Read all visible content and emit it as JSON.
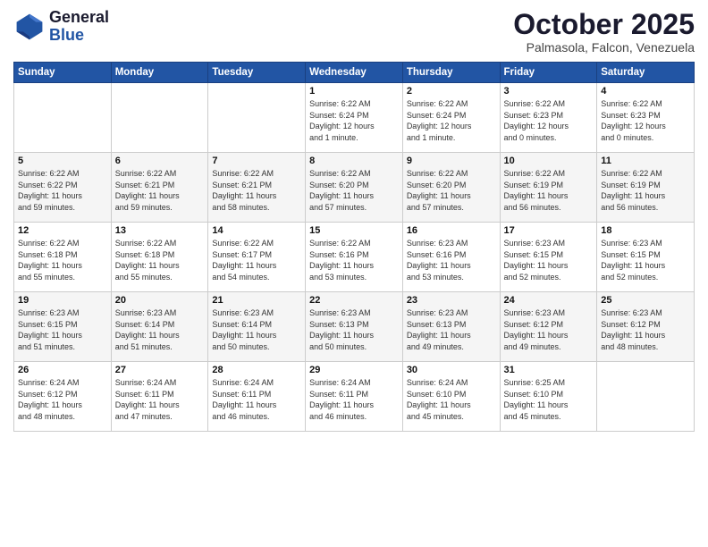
{
  "logo": {
    "line1": "General",
    "line2": "Blue"
  },
  "header": {
    "title": "October 2025",
    "subtitle": "Palmasola, Falcon, Venezuela"
  },
  "weekdays": [
    "Sunday",
    "Monday",
    "Tuesday",
    "Wednesday",
    "Thursday",
    "Friday",
    "Saturday"
  ],
  "weeks": [
    [
      {
        "day": "",
        "info": ""
      },
      {
        "day": "",
        "info": ""
      },
      {
        "day": "",
        "info": ""
      },
      {
        "day": "1",
        "info": "Sunrise: 6:22 AM\nSunset: 6:24 PM\nDaylight: 12 hours\nand 1 minute."
      },
      {
        "day": "2",
        "info": "Sunrise: 6:22 AM\nSunset: 6:24 PM\nDaylight: 12 hours\nand 1 minute."
      },
      {
        "day": "3",
        "info": "Sunrise: 6:22 AM\nSunset: 6:23 PM\nDaylight: 12 hours\nand 0 minutes."
      },
      {
        "day": "4",
        "info": "Sunrise: 6:22 AM\nSunset: 6:23 PM\nDaylight: 12 hours\nand 0 minutes."
      }
    ],
    [
      {
        "day": "5",
        "info": "Sunrise: 6:22 AM\nSunset: 6:22 PM\nDaylight: 11 hours\nand 59 minutes."
      },
      {
        "day": "6",
        "info": "Sunrise: 6:22 AM\nSunset: 6:21 PM\nDaylight: 11 hours\nand 59 minutes."
      },
      {
        "day": "7",
        "info": "Sunrise: 6:22 AM\nSunset: 6:21 PM\nDaylight: 11 hours\nand 58 minutes."
      },
      {
        "day": "8",
        "info": "Sunrise: 6:22 AM\nSunset: 6:20 PM\nDaylight: 11 hours\nand 57 minutes."
      },
      {
        "day": "9",
        "info": "Sunrise: 6:22 AM\nSunset: 6:20 PM\nDaylight: 11 hours\nand 57 minutes."
      },
      {
        "day": "10",
        "info": "Sunrise: 6:22 AM\nSunset: 6:19 PM\nDaylight: 11 hours\nand 56 minutes."
      },
      {
        "day": "11",
        "info": "Sunrise: 6:22 AM\nSunset: 6:19 PM\nDaylight: 11 hours\nand 56 minutes."
      }
    ],
    [
      {
        "day": "12",
        "info": "Sunrise: 6:22 AM\nSunset: 6:18 PM\nDaylight: 11 hours\nand 55 minutes."
      },
      {
        "day": "13",
        "info": "Sunrise: 6:22 AM\nSunset: 6:18 PM\nDaylight: 11 hours\nand 55 minutes."
      },
      {
        "day": "14",
        "info": "Sunrise: 6:22 AM\nSunset: 6:17 PM\nDaylight: 11 hours\nand 54 minutes."
      },
      {
        "day": "15",
        "info": "Sunrise: 6:22 AM\nSunset: 6:16 PM\nDaylight: 11 hours\nand 53 minutes."
      },
      {
        "day": "16",
        "info": "Sunrise: 6:23 AM\nSunset: 6:16 PM\nDaylight: 11 hours\nand 53 minutes."
      },
      {
        "day": "17",
        "info": "Sunrise: 6:23 AM\nSunset: 6:15 PM\nDaylight: 11 hours\nand 52 minutes."
      },
      {
        "day": "18",
        "info": "Sunrise: 6:23 AM\nSunset: 6:15 PM\nDaylight: 11 hours\nand 52 minutes."
      }
    ],
    [
      {
        "day": "19",
        "info": "Sunrise: 6:23 AM\nSunset: 6:15 PM\nDaylight: 11 hours\nand 51 minutes."
      },
      {
        "day": "20",
        "info": "Sunrise: 6:23 AM\nSunset: 6:14 PM\nDaylight: 11 hours\nand 51 minutes."
      },
      {
        "day": "21",
        "info": "Sunrise: 6:23 AM\nSunset: 6:14 PM\nDaylight: 11 hours\nand 50 minutes."
      },
      {
        "day": "22",
        "info": "Sunrise: 6:23 AM\nSunset: 6:13 PM\nDaylight: 11 hours\nand 50 minutes."
      },
      {
        "day": "23",
        "info": "Sunrise: 6:23 AM\nSunset: 6:13 PM\nDaylight: 11 hours\nand 49 minutes."
      },
      {
        "day": "24",
        "info": "Sunrise: 6:23 AM\nSunset: 6:12 PM\nDaylight: 11 hours\nand 49 minutes."
      },
      {
        "day": "25",
        "info": "Sunrise: 6:23 AM\nSunset: 6:12 PM\nDaylight: 11 hours\nand 48 minutes."
      }
    ],
    [
      {
        "day": "26",
        "info": "Sunrise: 6:24 AM\nSunset: 6:12 PM\nDaylight: 11 hours\nand 48 minutes."
      },
      {
        "day": "27",
        "info": "Sunrise: 6:24 AM\nSunset: 6:11 PM\nDaylight: 11 hours\nand 47 minutes."
      },
      {
        "day": "28",
        "info": "Sunrise: 6:24 AM\nSunset: 6:11 PM\nDaylight: 11 hours\nand 46 minutes."
      },
      {
        "day": "29",
        "info": "Sunrise: 6:24 AM\nSunset: 6:11 PM\nDaylight: 11 hours\nand 46 minutes."
      },
      {
        "day": "30",
        "info": "Sunrise: 6:24 AM\nSunset: 6:10 PM\nDaylight: 11 hours\nand 45 minutes."
      },
      {
        "day": "31",
        "info": "Sunrise: 6:25 AM\nSunset: 6:10 PM\nDaylight: 11 hours\nand 45 minutes."
      },
      {
        "day": "",
        "info": ""
      }
    ]
  ]
}
